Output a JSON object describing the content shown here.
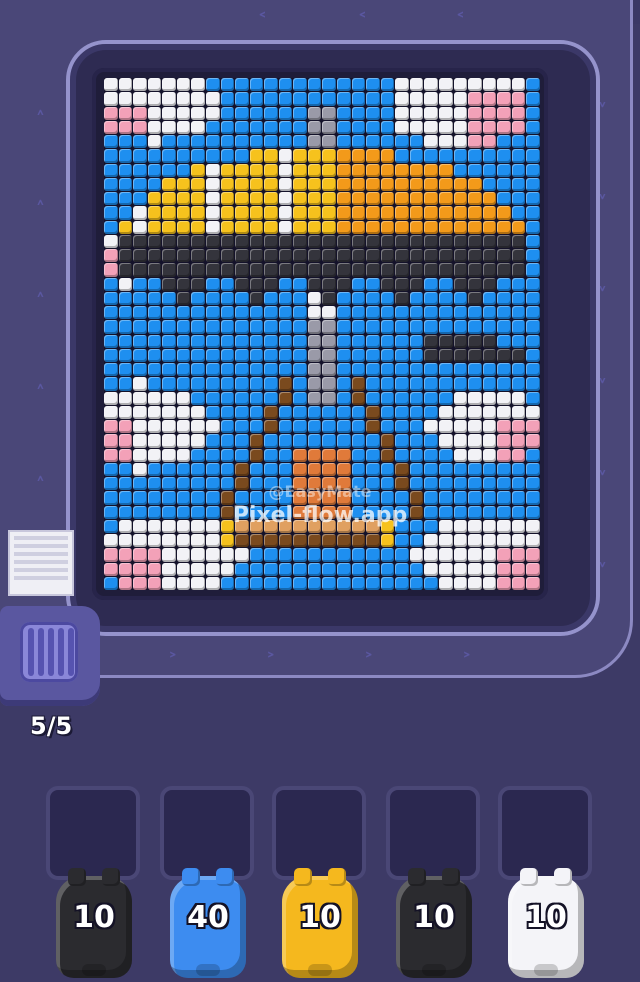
{
  "game": {
    "ammo_counter": "5/5",
    "watermark_line1": "@EasyMate",
    "watermark_line2": "Pixel-flow.app"
  },
  "pigs": [
    {
      "count": "10",
      "color": "#2b2b2f",
      "name": "black"
    },
    {
      "count": "40",
      "color": "#3d8cf0",
      "name": "blue"
    },
    {
      "count": "10",
      "color": "#f5b81e",
      "name": "yellow"
    },
    {
      "count": "10",
      "color": "#2b2b2f",
      "name": "black"
    },
    {
      "count": "10",
      "color": "#f4f4f8",
      "name": "white"
    }
  ],
  "palette": {
    "sky": "#1e8ff0",
    "white": "#f2f2f6",
    "pink": "#f3a1b8",
    "yellow": "#f6c21d",
    "orange": "#f39a1a",
    "dark": "#34343c",
    "gray": "#9a9aa8",
    "brown": "#7a4a1e",
    "tan": "#e0a060",
    "face": "#e07a3a"
  },
  "board": {
    "columns": 30,
    "rows": 36
  }
}
